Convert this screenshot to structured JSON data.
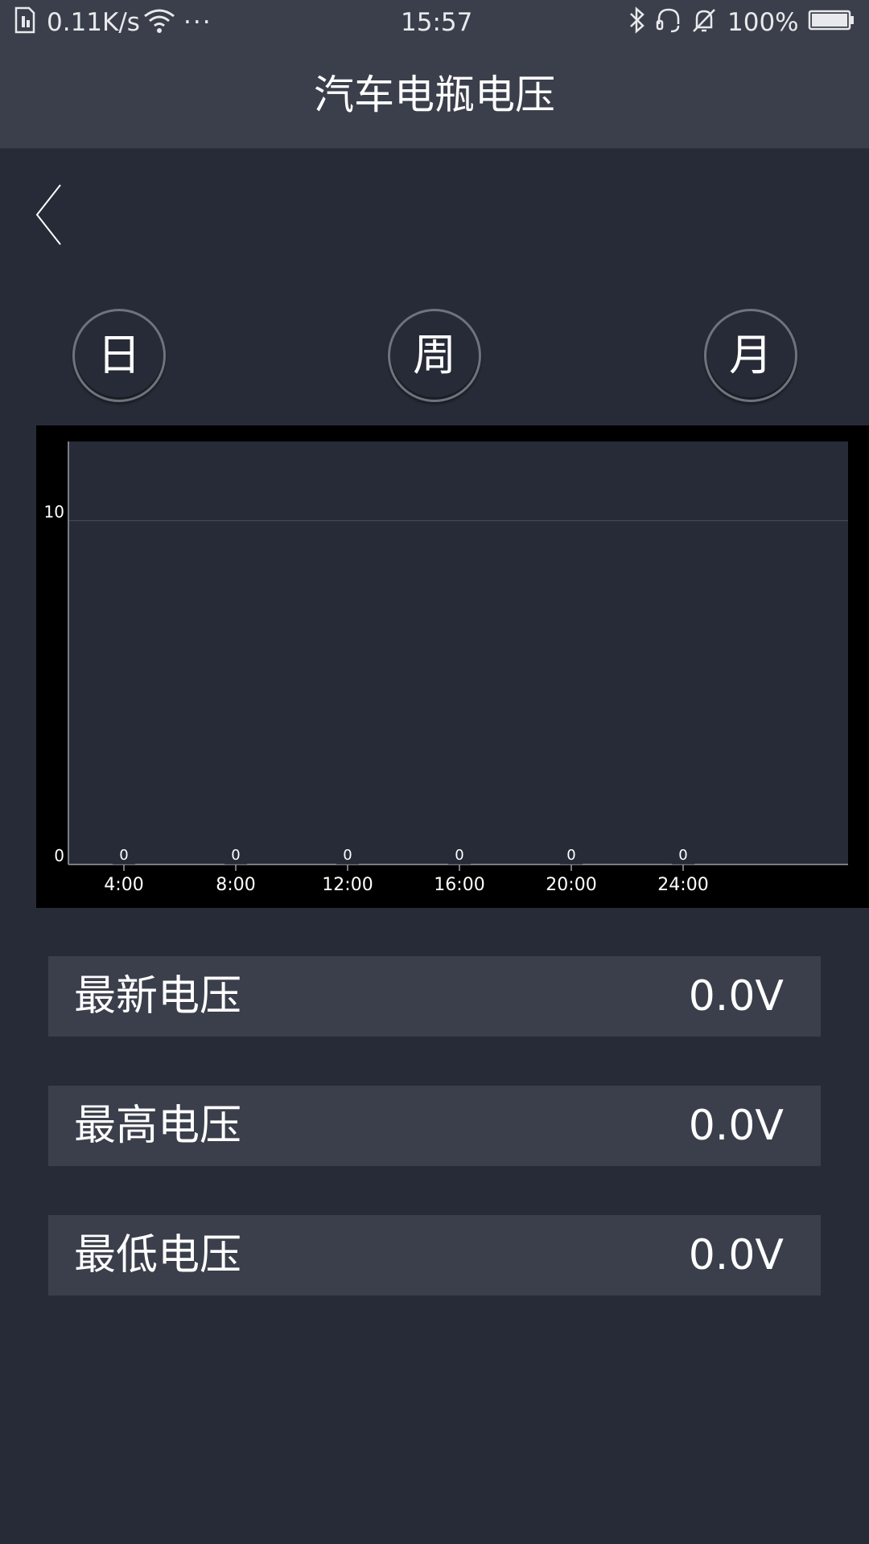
{
  "status_bar": {
    "net_speed": "0.11K/s",
    "more": "···",
    "time": "15:57",
    "battery": "100%"
  },
  "header": {
    "title": "汽车电瓶电压"
  },
  "period_tabs": [
    {
      "label": "日"
    },
    {
      "label": "周"
    },
    {
      "label": "月"
    }
  ],
  "chart_data": {
    "type": "bar",
    "categories": [
      "4:00",
      "8:00",
      "12:00",
      "16:00",
      "20:00",
      "24:00"
    ],
    "values": [
      0,
      0,
      0,
      0,
      0,
      0
    ],
    "data_labels": [
      "0",
      "0",
      "0",
      "0",
      "0",
      "0"
    ],
    "y_ticks": [
      "0",
      "10"
    ],
    "ylim": [
      0,
      12.3
    ],
    "grid": true,
    "colors": {
      "frame": "#000000",
      "plot": "#262b37",
      "axis": "#9a9ea6",
      "grid": "#4a4f5a",
      "text": "#ffffff"
    }
  },
  "stats": [
    {
      "label": "最新电压",
      "value": "0.0V"
    },
    {
      "label": "最高电压",
      "value": "0.0V"
    },
    {
      "label": "最低电压",
      "value": "0.0V"
    }
  ]
}
